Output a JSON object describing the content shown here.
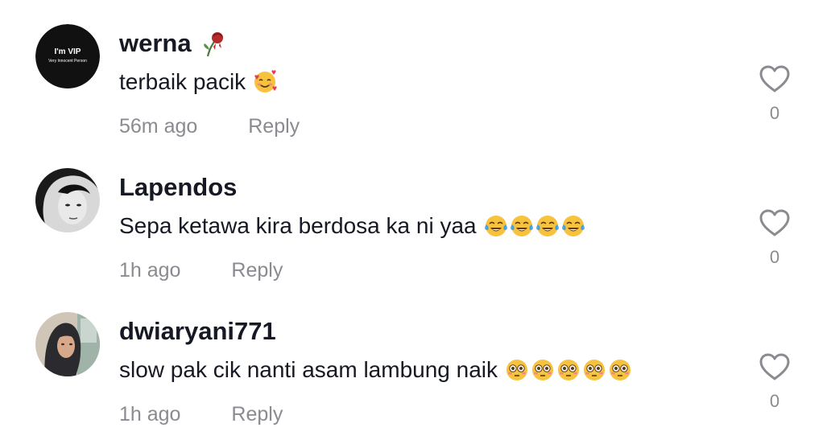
{
  "comments": [
    {
      "username": "werna",
      "username_emoji": "wilted-rose-icon",
      "avatar": {
        "line1": "I'm VIP",
        "line2": "Very Innocent Person"
      },
      "text": "terbaik pacik",
      "emojis": [
        "smiling-face-with-hearts-icon"
      ],
      "time": "56m ago",
      "reply_label": "Reply",
      "like_count": "0"
    },
    {
      "username": "Lapendos",
      "text": "Sepa ketawa kira berdosa ka ni yaa",
      "emojis": [
        "tears-of-joy-icon",
        "tears-of-joy-icon",
        "tears-of-joy-icon",
        "tears-of-joy-icon"
      ],
      "time": "1h ago",
      "reply_label": "Reply",
      "like_count": "0"
    },
    {
      "username": "dwiaryani771",
      "text": "slow pak cik nanti asam lambung naik",
      "emojis": [
        "flushed-face-icon",
        "flushed-face-icon",
        "flushed-face-icon",
        "flushed-face-icon",
        "flushed-face-icon"
      ],
      "time": "1h ago",
      "reply_label": "Reply",
      "like_count": "0"
    }
  ],
  "colors": {
    "primary_text": "#161823",
    "secondary_text": "#8a8b91",
    "heart_outline": "#8a8b91"
  }
}
